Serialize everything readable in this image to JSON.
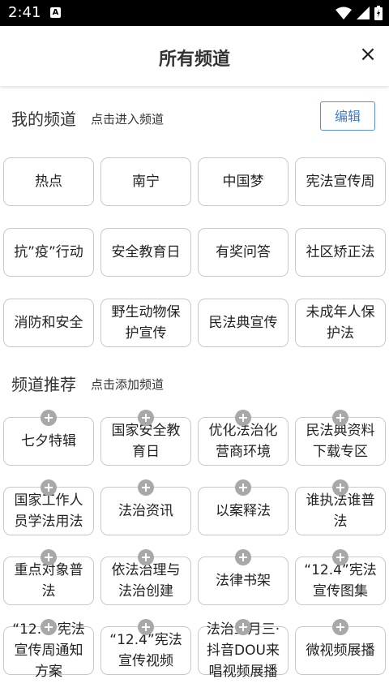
{
  "status": {
    "time": "2:41",
    "notif_letter": "A"
  },
  "header": {
    "title": "所有频道",
    "close_label": "×"
  },
  "my_channels": {
    "title": "我的频道",
    "hint": "点击进入频道",
    "edit_label": "编辑",
    "items": [
      "热点",
      "南宁",
      "中国梦",
      "宪法宣传周",
      "抗”疫”行动",
      "安全教育日",
      "有奖问答",
      "社区矫正法",
      "消防和安全",
      "野生动物保护宣传",
      "民法典宣传",
      "未成年人保护法"
    ]
  },
  "recommended": {
    "title": "频道推荐",
    "hint": "点击添加频道",
    "items": [
      "七夕特辑",
      "国家安全教育日",
      "优化法治化营商环境",
      "民法典资料下载专区",
      "国家工作人员学法用法",
      "法治资讯",
      "以案释法",
      "谁执法谁普法",
      "重点对象普法",
      "依法治理与法治创建",
      "法律书架",
      "“12.4”宪法宣传图集",
      "“12.4”宪法宣传周通知方案",
      "“12.4”宪法宣传视频",
      "法治三月三·抖音DOU来唱视频展播",
      "微视频展播"
    ]
  }
}
